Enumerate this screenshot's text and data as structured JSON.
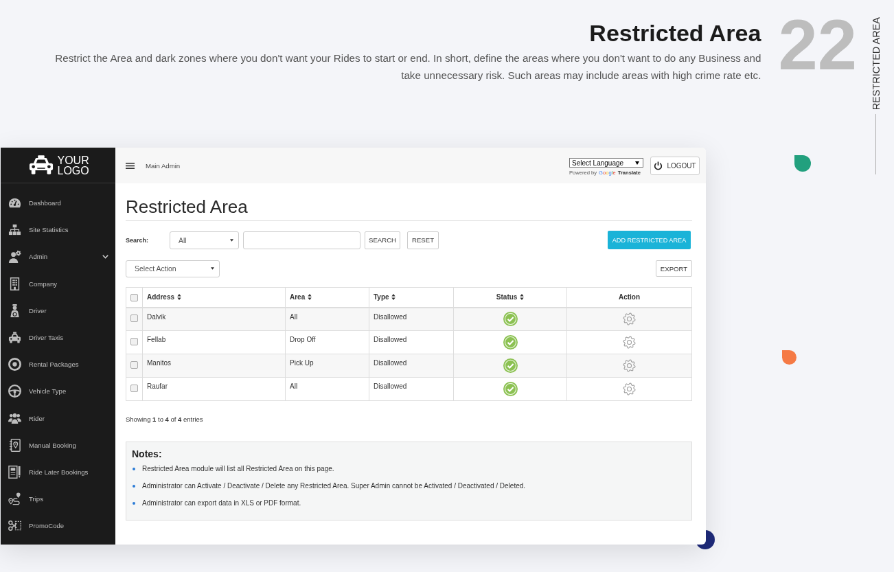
{
  "header": {
    "title": "Restricted Area",
    "description": "Restrict the Area and dark zones where you don't want your Rides to start or end. In short, define the areas where you don't want to do any Business and take unnecessary risk. Such areas may include areas with high crime rate etc.",
    "number": "22",
    "side_label": "RESTRICTED AREA"
  },
  "decorations": [
    {
      "color": "#22a07e"
    },
    {
      "color": "#f57a45"
    },
    {
      "color": "#1e2a7a"
    }
  ],
  "sidebar": {
    "logo": "YOUR LOGO",
    "items": [
      {
        "label": "Dashboard",
        "kind": "link"
      },
      {
        "label": "Site Statistics",
        "kind": "link"
      },
      {
        "label": "Admin",
        "kind": "submenu"
      },
      {
        "label": "Company",
        "kind": "link"
      },
      {
        "label": "Driver",
        "kind": "link"
      },
      {
        "label": "Driver Taxis",
        "kind": "link"
      },
      {
        "label": "Rental Packages",
        "kind": "link"
      },
      {
        "label": "Vehicle Type",
        "kind": "link"
      },
      {
        "label": "Rider",
        "kind": "link"
      },
      {
        "label": "Manual Booking",
        "kind": "link"
      },
      {
        "label": "Ride Later Bookings",
        "kind": "link"
      },
      {
        "label": "Trips",
        "kind": "link"
      },
      {
        "label": "PromoCode",
        "kind": "link"
      }
    ]
  },
  "topbar": {
    "user": "Main Admin",
    "language": {
      "value": "Select Language",
      "powered_by": "Powered by",
      "brand": "Google",
      "action": "Translate"
    },
    "logout": "LOGOUT"
  },
  "page_title": "Restricted Area",
  "search": {
    "label": "Search:",
    "filter": {
      "value": "All"
    },
    "search_button": "SEARCH",
    "reset_button": "RESET"
  },
  "add_button": "ADD RESTRICTED AREA",
  "bulk_action": {
    "value": "Select Action"
  },
  "export_button": "EXPORT",
  "table": {
    "select_all": {
      "checked": false
    },
    "columns": [
      {
        "label": "Address",
        "sortable": true
      },
      {
        "label": "Area",
        "sortable": true
      },
      {
        "label": "Type",
        "sortable": true
      },
      {
        "label": "Status",
        "sortable": true
      },
      {
        "label": "Action",
        "sortable": false
      }
    ],
    "rows": [
      {
        "checked": false,
        "address": "Dalvik",
        "area": "All",
        "type": "Disallowed",
        "active": true
      },
      {
        "checked": false,
        "address": "Fellab",
        "area": "Drop Off",
        "type": "Disallowed",
        "active": true
      },
      {
        "checked": false,
        "address": "Manitos",
        "area": "Pick Up",
        "type": "Disallowed",
        "active": true
      },
      {
        "checked": false,
        "address": "Raufar",
        "area": "All",
        "type": "Disallowed",
        "active": true
      }
    ]
  },
  "summary": "Showing **1** to **4** of **4** entries",
  "notes": {
    "title": "Notes:",
    "items": [
      "Restricted Area module will list all Restricted Area on this page.",
      "Administrator can Activate / Deactivate / Delete any Restricted Area. Super Admin cannot be Activated / Deactivated / Deleted.",
      "Administrator can export data in XLS or PDF format."
    ]
  }
}
